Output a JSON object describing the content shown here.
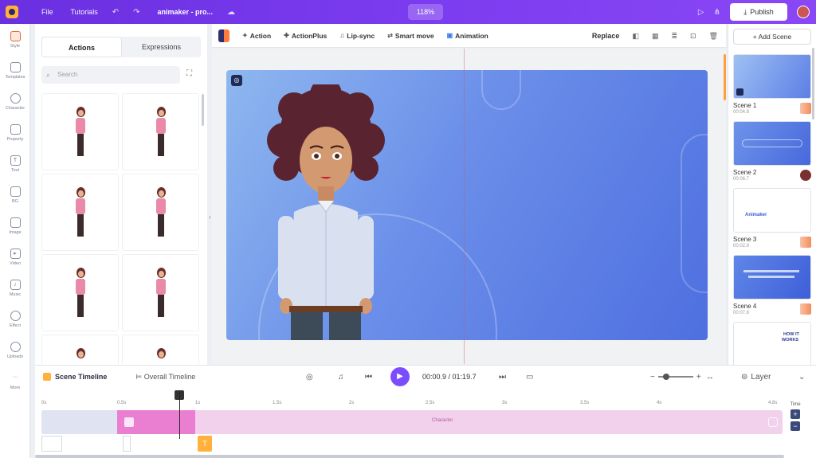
{
  "topbar": {
    "file": "File",
    "tutorials": "Tutorials",
    "project_name": "animaker - pro...",
    "zoom": "118%",
    "publish": "Publish"
  },
  "rail": [
    {
      "label": "Style",
      "icon": "style-icon"
    },
    {
      "label": "Templates",
      "icon": "templates-icon"
    },
    {
      "label": "Character",
      "icon": "character-icon"
    },
    {
      "label": "Property",
      "icon": "property-icon"
    },
    {
      "label": "Text",
      "icon": "text-icon"
    },
    {
      "label": "BG",
      "icon": "bg-icon"
    },
    {
      "label": "Image",
      "icon": "image-icon"
    },
    {
      "label": "Video",
      "icon": "video-icon"
    },
    {
      "label": "Music",
      "icon": "music-icon"
    },
    {
      "label": "Effect",
      "icon": "effect-icon"
    },
    {
      "label": "Uploads",
      "icon": "uploads-icon"
    },
    {
      "label": "More",
      "icon": "more-icon"
    }
  ],
  "library": {
    "tabs": [
      "Actions",
      "Expressions"
    ],
    "search_placeholder": "Search"
  },
  "toolbar": {
    "tools": [
      "Action",
      "ActionPlus",
      "Lip-sync",
      "Smart move",
      "Animation"
    ],
    "replace": "Replace"
  },
  "scenes": {
    "add_label": "+ Add Scene",
    "items": [
      {
        "name": "Scene 1",
        "time": "00:04.8"
      },
      {
        "name": "Scene 2",
        "time": "00:06.7"
      },
      {
        "name": "Scene 3",
        "time": "00:02.9"
      },
      {
        "name": "Scene 4",
        "time": "00:07.6"
      }
    ],
    "thumb_text": {
      "s3_logo": "Animaker",
      "s5_line1": "HOW IT",
      "s5_line2": "WORKS"
    }
  },
  "timeline": {
    "scene_tab": "Scene Timeline",
    "overall_tab": "Overall Timeline",
    "current": "00:00.9",
    "total": "01:19.7",
    "layer": "Layer",
    "ruler": [
      "0s",
      "0.5s",
      "1s",
      "1.5s",
      "2s",
      "2.5s",
      "3s",
      "3.5s",
      "4s",
      "4.8s"
    ],
    "track_label": "Character",
    "time_label": "Time",
    "text_marker": "T"
  },
  "colors": {
    "brand": "#7c3df0",
    "accent": "#ffb13c",
    "play": "#7c4dff"
  }
}
